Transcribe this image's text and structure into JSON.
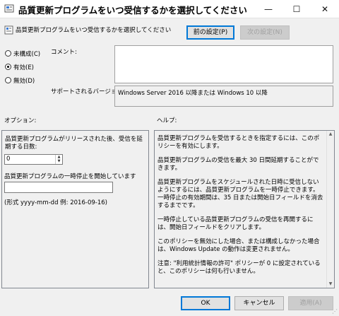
{
  "window": {
    "title": "品質更新プログラムをいつ受信するかを選択してください",
    "minimize_glyph": "—",
    "maximize_glyph": "☐",
    "close_glyph": "✕"
  },
  "header": {
    "setting_name": "品質更新プログラムをいつ受信するかを選択してください",
    "prev_button": "前の設定(P)",
    "next_button": "次の設定(N)"
  },
  "state": {
    "not_configured": "未構成(C)",
    "enabled": "有効(E)",
    "disabled": "無効(D)",
    "selected": "enabled"
  },
  "comment_label": "コメント:",
  "supported": {
    "label": "サポートされるバージョン:",
    "value": "Windows Server 2016 以降または Windows 10 以降"
  },
  "options": {
    "label": "オプション:",
    "defer_label": "品質更新プログラムがリリースされた後、受信を延期する日数:",
    "defer_value": "0",
    "pause_label": "品質更新プログラムの一時停止を開始しています",
    "pause_value": "",
    "format_hint": "(形式 yyyy-mm-dd 例: 2016-09-16)"
  },
  "help": {
    "label": "ヘルプ:",
    "paragraphs": [
      "品質更新プログラムを受信するときを指定するには、このポリシーを有効にします。",
      "品質更新プログラムの受信を最大 30 日間延期することができます。",
      "品質更新プログラムをスケジュールされた日時に受信しないようにするには、品質更新プログラムを一時停止できます。一時停止の有効期間は、35 日または開始日フィールドを消去するまでです。",
      "一時停止している品質更新プログラムの受信を再開するには、開始日フィールドをクリアします。",
      "このポリシーを無効にした場合、または構成しなかった場合は、Windows Update の動作は変更されません。",
      "注意: \"利用統計情報の許可\" ポリシーが 0 に設定されていると、このポリシーは何も行いません。"
    ]
  },
  "footer": {
    "ok": "OK",
    "cancel": "キャンセル",
    "apply": "適用(A)"
  }
}
